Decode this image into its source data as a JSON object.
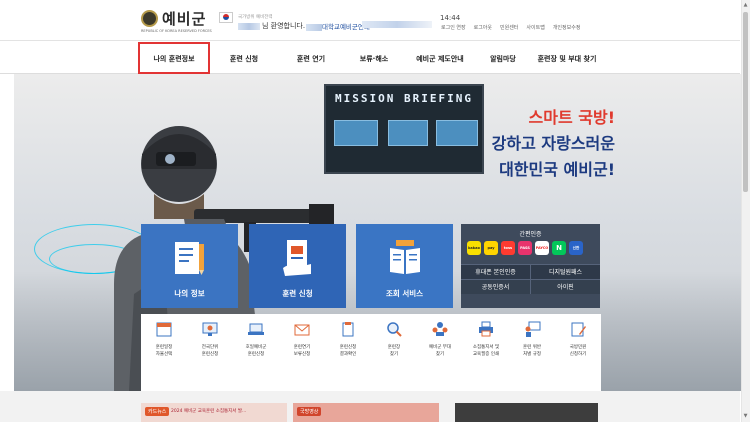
{
  "header": {
    "logo_text": "예비군",
    "logo_subtitle": "REPUBLIC OF KOREA RESERVED FORCES",
    "welcome_small": "국가방위 예비전력",
    "welcome_text": "님 환영합니다.",
    "unit_text": "대학교예비군연대",
    "time": "14:44",
    "utility_links": [
      "로그인 연장",
      "로그아웃",
      "민원센터",
      "사이트맵",
      "개인정보수정"
    ]
  },
  "nav": {
    "items": [
      "나의 훈련정보",
      "훈련 신청",
      "훈련 연기",
      "보류·해소",
      "예비군 제도안내",
      "알림마당",
      "훈련장 및 부대 찾기"
    ]
  },
  "hero": {
    "sign": "MISSION BRIEFING",
    "slogan_line1": "스마트 국방!",
    "slogan_line2": "강하고 자랑스러운",
    "slogan_line3": "대한민국 예비군!"
  },
  "tiles": [
    "나의 정보",
    "훈련 신청",
    "조회 서비스"
  ],
  "auth": {
    "title": "간편인증",
    "providers": [
      {
        "name": "kakao",
        "color": "#f9e000"
      },
      {
        "name": "pay",
        "color": "#ffd400"
      },
      {
        "name": "toss",
        "color": "#ff3b30"
      },
      {
        "name": "PASS",
        "color": "#e8336d"
      },
      {
        "name": "PAYCO",
        "color": "#ffffff"
      },
      {
        "name": "N",
        "color": "#03c75a"
      },
      {
        "name": "신한",
        "color": "#2a64c8"
      }
    ],
    "row1": [
      "휴대폰 본인인증",
      "디지털원패스"
    ],
    "row2": [
      "공동인증서",
      "아이핀"
    ]
  },
  "quick_menu": [
    {
      "line1": "훈련일정",
      "line2": "자율선택"
    },
    {
      "line1": "전국단위",
      "line2": "훈련신청"
    },
    {
      "line1": "호일예비군",
      "line2": "훈련신청"
    },
    {
      "line1": "훈련연기",
      "line2": "보류신청"
    },
    {
      "line1": "훈련신청",
      "line2": "결과확인"
    },
    {
      "line1": "훈련장",
      "line2": "찾기"
    },
    {
      "line1": "예비군 부대",
      "line2": "찾기"
    },
    {
      "line1": "소집통지서 및",
      "line2": "교육필증 인쇄"
    },
    {
      "line1": "훈련 위반",
      "line2": "처벌 규정"
    },
    {
      "line1": "국방민원",
      "line2": "신청하기"
    }
  ],
  "cards": {
    "card1_badge": "카드뉴스",
    "card1_text": "2024 예비군 교육훈련 소집통지서 발...",
    "card2_badge": "국방영상"
  }
}
